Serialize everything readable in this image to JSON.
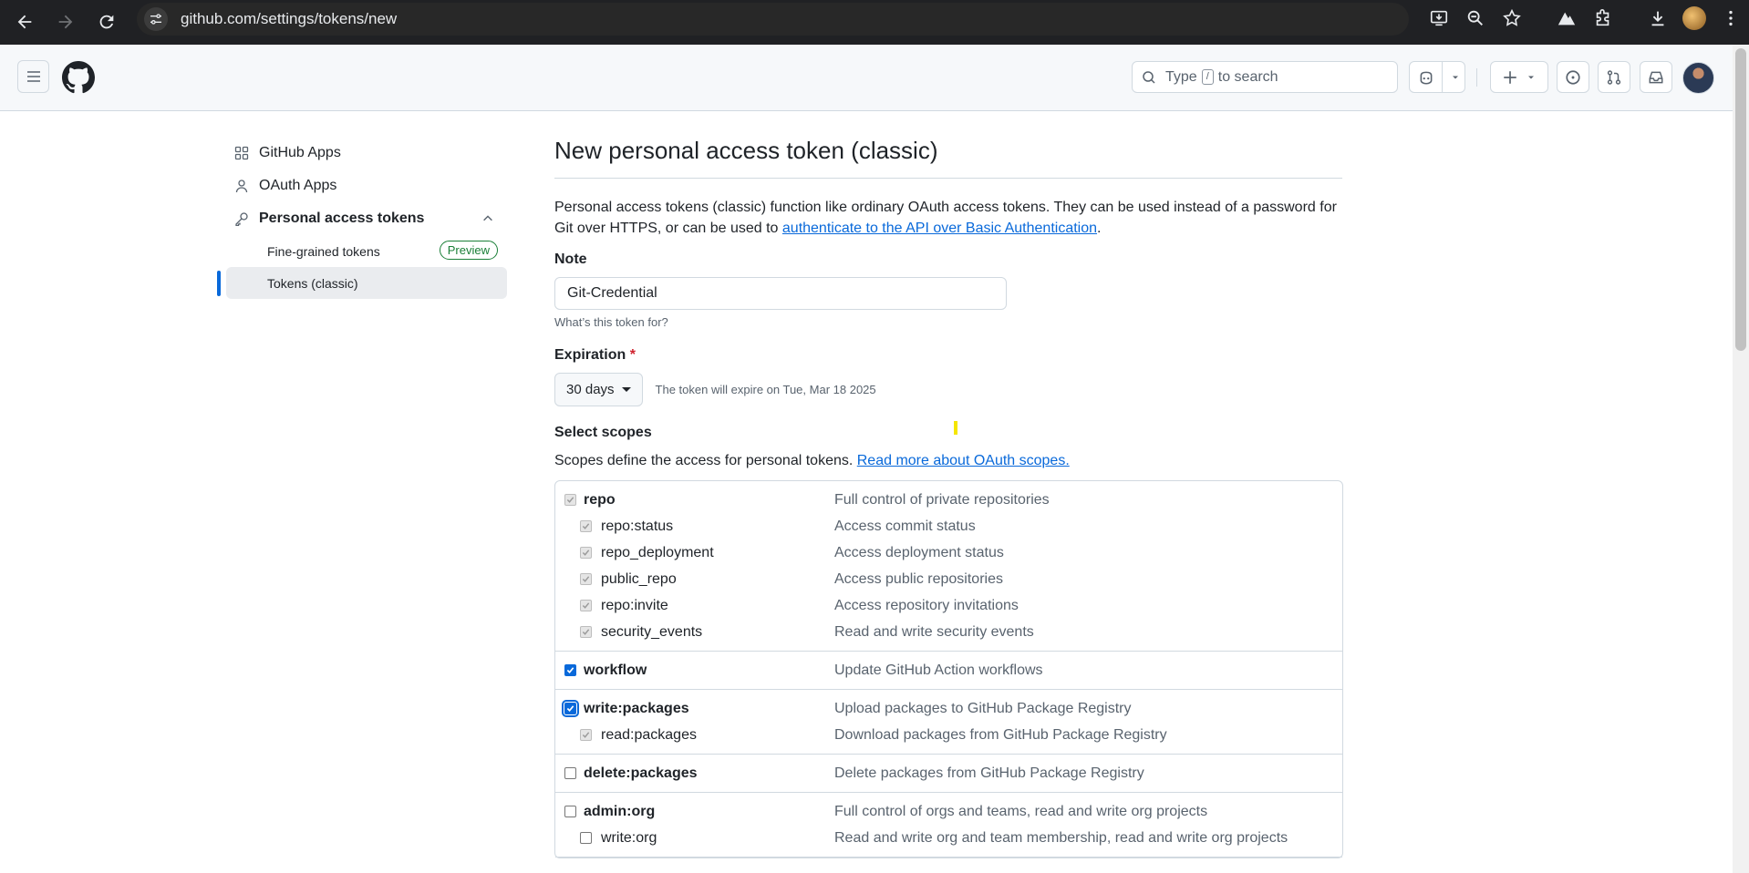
{
  "browser": {
    "url": "github.com/settings/tokens/new"
  },
  "header": {
    "search_placeholder_prefix": "Type",
    "search_key": "/",
    "search_placeholder_suffix": "to search"
  },
  "sidebar": {
    "items": [
      {
        "label": "GitHub Apps",
        "icon": "apps-icon"
      },
      {
        "label": "OAuth Apps",
        "icon": "person-icon"
      },
      {
        "label": "Personal access tokens",
        "icon": "key-icon"
      }
    ],
    "sub_items": [
      {
        "label": "Fine-grained tokens",
        "badge": "Preview"
      },
      {
        "label": "Tokens (classic)"
      }
    ]
  },
  "main": {
    "title": "New personal access token (classic)",
    "intro_text": "Personal access tokens (classic) function like ordinary OAuth access tokens. They can be used instead of a password for Git over HTTPS, or can be used to ",
    "intro_link": "authenticate to the API over Basic Authentication",
    "intro_end": ".",
    "note_label": "Note",
    "note_value": "Git-Credential",
    "note_hint": "What’s this token for?",
    "expiration_label": "Expiration",
    "expiration_required": "*",
    "expiration_value": "30 days",
    "expiration_note": "The token will expire on Tue, Mar 18 2025",
    "scopes_label": "Select scopes",
    "scopes_desc": "Scopes define the access for personal tokens. ",
    "scopes_link": "Read more about OAuth scopes."
  },
  "scope_groups": [
    {
      "rows": [
        {
          "name": "repo",
          "desc": "Full control of private repositories",
          "state": "disabled-checked",
          "sub": false
        },
        {
          "name": "repo:status",
          "desc": "Access commit status",
          "state": "disabled-checked",
          "sub": true
        },
        {
          "name": "repo_deployment",
          "desc": "Access deployment status",
          "state": "disabled-checked",
          "sub": true
        },
        {
          "name": "public_repo",
          "desc": "Access public repositories",
          "state": "disabled-checked",
          "sub": true
        },
        {
          "name": "repo:invite",
          "desc": "Access repository invitations",
          "state": "disabled-checked",
          "sub": true
        },
        {
          "name": "security_events",
          "desc": "Read and write security events",
          "state": "disabled-checked",
          "sub": true
        }
      ]
    },
    {
      "rows": [
        {
          "name": "workflow",
          "desc": "Update GitHub Action workflows",
          "state": "checked",
          "sub": false
        }
      ]
    },
    {
      "rows": [
        {
          "name": "write:packages",
          "desc": "Upload packages to GitHub Package Registry",
          "state": "checked-focus",
          "sub": false
        },
        {
          "name": "read:packages",
          "desc": "Download packages from GitHub Package Registry",
          "state": "disabled-checked",
          "sub": true
        }
      ]
    },
    {
      "rows": [
        {
          "name": "delete:packages",
          "desc": "Delete packages from GitHub Package Registry",
          "state": "unchecked",
          "sub": false
        }
      ]
    },
    {
      "rows": [
        {
          "name": "admin:org",
          "desc": "Full control of orgs and teams, read and write org projects",
          "state": "unchecked",
          "sub": false
        },
        {
          "name": "write:org",
          "desc": "Read and write org and team membership, read and write org projects",
          "state": "unchecked",
          "sub": true
        }
      ]
    }
  ]
}
